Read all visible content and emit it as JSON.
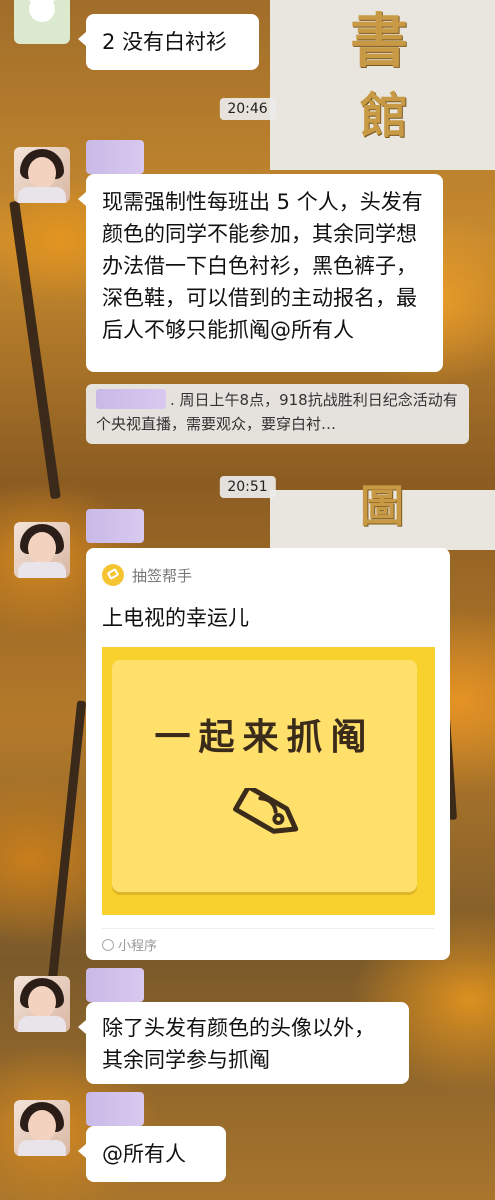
{
  "messages": {
    "m1": {
      "text": "2 没有白衬衫"
    },
    "time1": "20:46",
    "m2": {
      "text": "现需强制性每班出 5 个人，头发有颜色的同学不能参加，其余同学想办法借一下白色衬衫，黑色裤子，深色鞋，可以借到的主动报名，最后人不够只能抓阄@所有人"
    },
    "quote": {
      "text": ". 周日上午8点，918抗战胜利日纪念活动有个央视直播，需要观众，要穿白衬…"
    },
    "time2": "20:51",
    "mini_program": {
      "app_name": "抽签帮手",
      "title": "上电视的幸运儿",
      "image_text": "一起来抓阄",
      "footer": "小程序"
    },
    "m3": {
      "text": "除了头发有颜色的头像以外，其余同学参与抓阄"
    },
    "m4": {
      "text": "@所有人"
    }
  },
  "colors": {
    "bubble": "#ffffff",
    "mp_yellow": "#f8d12f",
    "nick_blur": "#c8b9e6"
  },
  "icons": [
    "bear-avatar-icon",
    "tag-icon",
    "mini-program-icon"
  ]
}
